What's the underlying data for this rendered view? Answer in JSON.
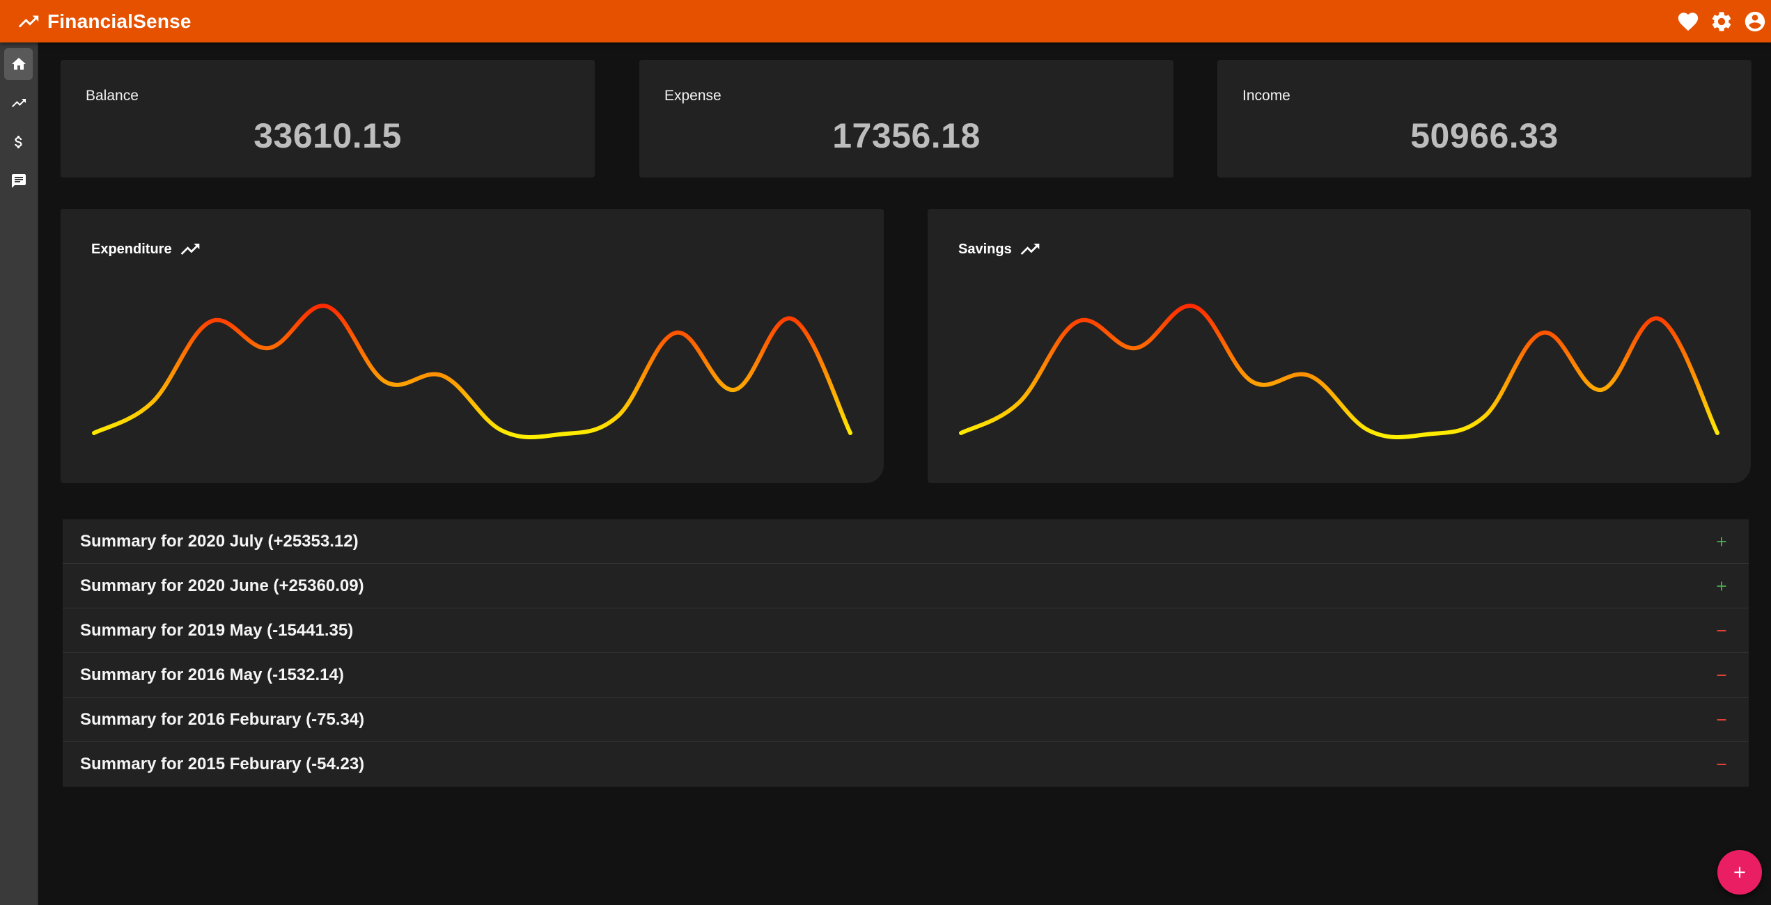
{
  "app": {
    "title": "FinancialSense"
  },
  "toolbar": {
    "icons": [
      "trending-up-icon",
      "heart-icon",
      "settings-icon",
      "account-icon"
    ]
  },
  "sidebar": {
    "items": [
      {
        "name": "home",
        "icon": "home-icon",
        "active": true
      },
      {
        "name": "trends",
        "icon": "trending-up-icon",
        "active": false
      },
      {
        "name": "money",
        "icon": "dollar-icon",
        "active": false
      },
      {
        "name": "messages",
        "icon": "message-icon",
        "active": false
      }
    ]
  },
  "stats": {
    "balance": {
      "label": "Balance",
      "value": "33610.15"
    },
    "expense": {
      "label": "Expense",
      "value": "17356.18"
    },
    "income": {
      "label": "Income",
      "value": "50966.33"
    }
  },
  "chart_data": [
    {
      "type": "line",
      "title": "Expenditure",
      "x": [
        0,
        1,
        2,
        3,
        4,
        5,
        6,
        7,
        8,
        9,
        10,
        11,
        12,
        13
      ],
      "values": [
        10,
        32,
        90,
        71,
        101,
        47,
        51,
        12,
        9,
        22,
        82,
        41,
        92,
        10
      ],
      "ylim": [
        0,
        110
      ],
      "grid": false,
      "gradient": [
        "#ffff00",
        "#ff1a00"
      ]
    },
    {
      "type": "line",
      "title": "Savings",
      "x": [
        0,
        1,
        2,
        3,
        4,
        5,
        6,
        7,
        8,
        9,
        10,
        11,
        12,
        13
      ],
      "values": [
        10,
        32,
        90,
        71,
        101,
        47,
        51,
        12,
        9,
        22,
        82,
        41,
        92,
        10
      ],
      "ylim": [
        0,
        110
      ],
      "grid": false,
      "gradient": [
        "#ffff00",
        "#ff1a00"
      ]
    }
  ],
  "summaries": [
    {
      "text": "Summary for 2020 July (+25353.12)",
      "sign": "plus"
    },
    {
      "text": "Summary for 2020 June (+25360.09)",
      "sign": "plus"
    },
    {
      "text": "Summary for 2019 May (-15441.35)",
      "sign": "minus"
    },
    {
      "text": "Summary for 2016 May (-1532.14)",
      "sign": "minus"
    },
    {
      "text": "Summary for 2016 Feburary (-75.34)",
      "sign": "minus"
    },
    {
      "text": "Summary for 2015 Feburary (-54.23)",
      "sign": "minus"
    }
  ],
  "colors": {
    "appbar": "#e65100",
    "positive": "#4caf50",
    "negative": "#f44336",
    "fab": "#e91e63"
  },
  "fab": {
    "icon": "plus-icon"
  }
}
